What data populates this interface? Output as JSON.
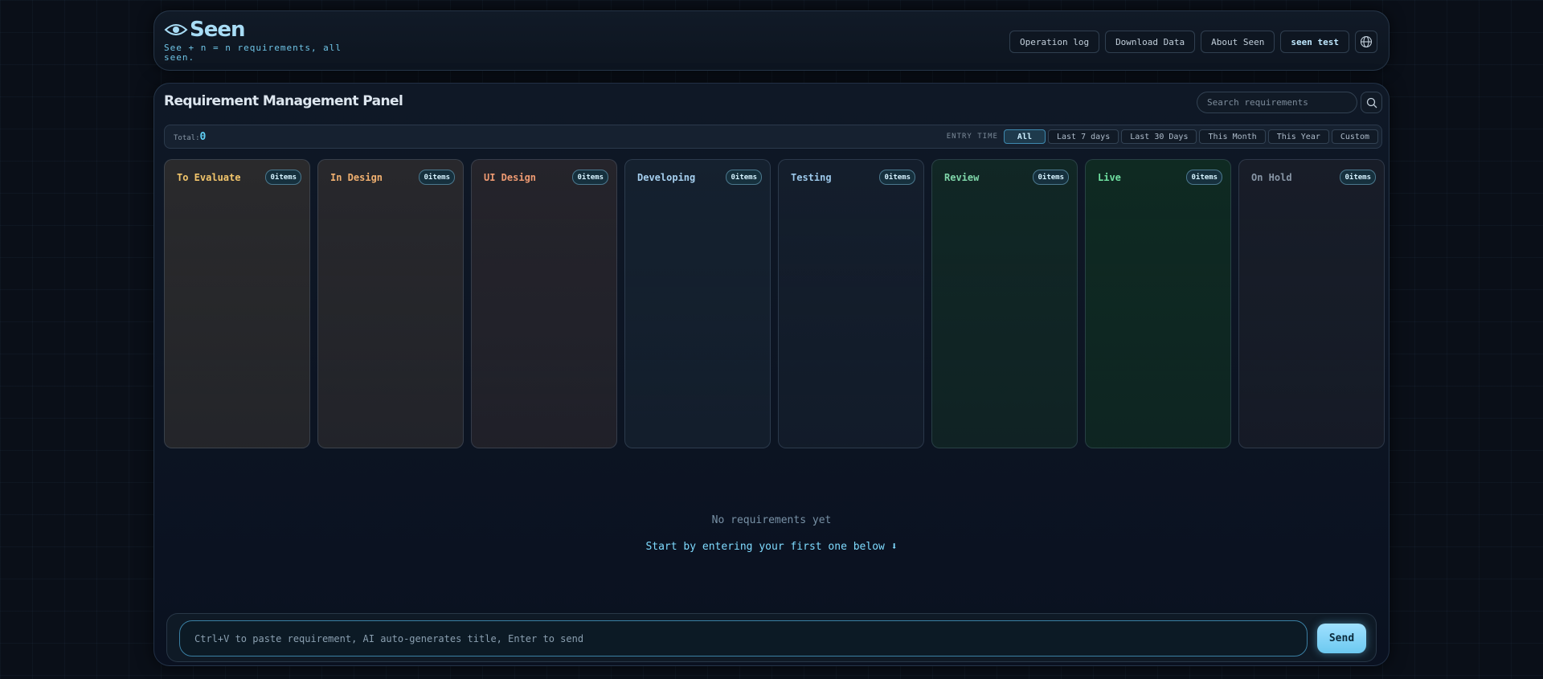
{
  "brand": {
    "name": "Seen",
    "tagline": "See + n = n requirements, all seen.",
    "eye_icon": "eye-icon"
  },
  "header": {
    "operation_log": "Operation log",
    "download_data": "Download Data",
    "about": "About Seen",
    "user": "seen test",
    "globe_icon": "globe-icon"
  },
  "panel": {
    "title": "Requirement Management Panel",
    "search_placeholder": "Search requirements",
    "search_icon": "search-icon"
  },
  "filter_bar": {
    "total_label": "Total:",
    "total_value": "0",
    "entry_time_label": "ENTRY TIME",
    "filters": [
      "All",
      "Last 7 days",
      "Last 30 Days",
      "This Month",
      "This Year",
      "Custom"
    ],
    "active_filter": "All"
  },
  "columns": [
    {
      "title": "To Evaluate",
      "count": "0items",
      "color": "#f2c56b",
      "bg": "#2a2a2c"
    },
    {
      "title": "In Design",
      "count": "0items",
      "color": "#f0b070",
      "bg": "#28282c"
    },
    {
      "title": "UI Design",
      "count": "0items",
      "color": "#ee9a72",
      "bg": "#25242b"
    },
    {
      "title": "Developing",
      "count": "0items",
      "color": "#a6d0f0",
      "bg": "#15212f"
    },
    {
      "title": "Testing",
      "count": "0items",
      "color": "#9cc8ea",
      "bg": "#141e2c"
    },
    {
      "title": "Review",
      "count": "0items",
      "color": "#7fd6a9",
      "bg": "#112725"
    },
    {
      "title": "Live",
      "count": "0items",
      "color": "#6fe0a0",
      "bg": "#0f2a22"
    },
    {
      "title": "On Hold",
      "count": "0items",
      "color": "#8896a6",
      "bg": "#181d28"
    }
  ],
  "empty_state": {
    "line1": "No requirements yet",
    "line2": "Start by entering your first one below ⬇"
  },
  "composer": {
    "placeholder": "Ctrl+V to paste requirement, AI auto-generates title, Enter to send",
    "send_label": "Send"
  }
}
